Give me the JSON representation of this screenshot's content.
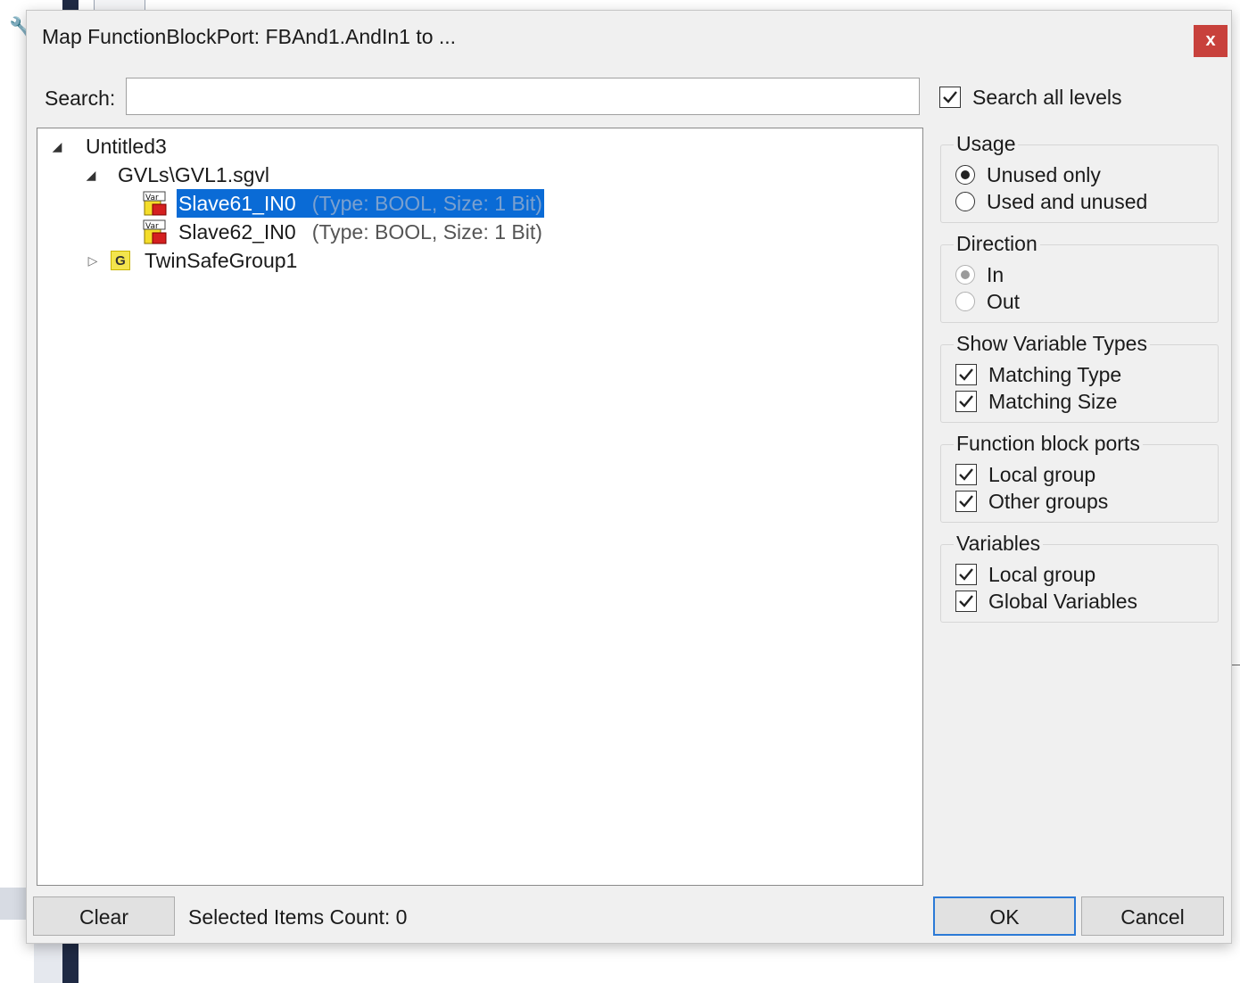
{
  "dialog": {
    "title": "Map FunctionBlockPort: FBAnd1.AndIn1 to ...",
    "close_glyph": "x"
  },
  "search": {
    "label": "Search:",
    "value": "",
    "placeholder": ""
  },
  "search_all_levels": {
    "label": "Search all levels",
    "checked": true
  },
  "tree": {
    "root": {
      "label": "Untitled3"
    },
    "gvl": {
      "label": "GVLs\\GVL1.sgvl"
    },
    "items": [
      {
        "name": "Slave61_IN0",
        "type_info": "(Type: BOOL, Size: 1 Bit)",
        "selected": true
      },
      {
        "name": "Slave62_IN0",
        "type_info": "(Type: BOOL, Size: 1 Bit)",
        "selected": false
      }
    ],
    "group": {
      "label": "TwinSafeGroup1",
      "icon_letter": "G"
    },
    "var_icon_text": "Var"
  },
  "usage": {
    "title": "Usage",
    "options": [
      {
        "label": "Unused only",
        "selected": true
      },
      {
        "label": "Used and unused",
        "selected": false
      }
    ]
  },
  "direction": {
    "title": "Direction",
    "options": [
      {
        "label": "In",
        "selected": true
      },
      {
        "label": "Out",
        "selected": false
      }
    ]
  },
  "show_variable_types": {
    "title": "Show Variable Types",
    "options": [
      {
        "label": "Matching Type",
        "checked": true
      },
      {
        "label": "Matching Size",
        "checked": true
      }
    ]
  },
  "function_block_ports": {
    "title": "Function block ports",
    "options": [
      {
        "label": "Local group",
        "checked": true
      },
      {
        "label": "Other groups",
        "checked": true
      }
    ]
  },
  "variables": {
    "title": "Variables",
    "options": [
      {
        "label": "Local group",
        "checked": true
      },
      {
        "label": "Global Variables",
        "checked": true
      }
    ]
  },
  "footer": {
    "clear_label": "Clear",
    "status": "Selected Items Count: 0",
    "ok_label": "OK",
    "cancel_label": "Cancel"
  },
  "colors": {
    "selection": "#0a6bd6",
    "close_button": "#c8413c",
    "default_button_border": "#2c7ad6"
  }
}
